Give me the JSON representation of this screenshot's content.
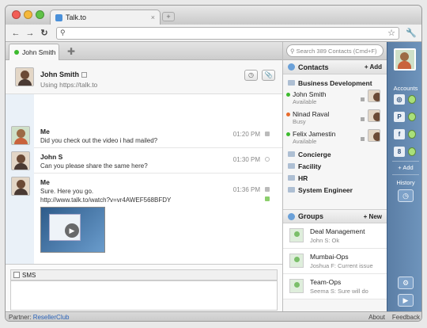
{
  "browser": {
    "tab_title": "Talk.to",
    "tab_close": "×",
    "new_tab": "+",
    "url": ""
  },
  "app_tabs": {
    "active": "John Smith",
    "add": "✚"
  },
  "chat_header": {
    "name": "John Smith",
    "subtitle": "Using https://talk.to"
  },
  "messages": [
    {
      "author": "Me",
      "text": "Did you check out the video i had mailed?",
      "time": "01:20 PM"
    },
    {
      "author": "John S",
      "text": "Can you please share the same here?",
      "time": "01:30 PM"
    },
    {
      "author": "Me",
      "text": "Sure. Here you go.",
      "link": "http://www.talk.to/watch?v=vr4AWEF568BFDY",
      "time": "01:36 PM"
    }
  ],
  "compose": {
    "sms_label": "SMS"
  },
  "search": {
    "placeholder": "Search 389 Contacts (Cmd+F)"
  },
  "contacts": {
    "title": "Contacts",
    "add": "+ Add",
    "folders": [
      {
        "label": "Business Development"
      },
      {
        "label": "Concierge"
      },
      {
        "label": "Facility"
      },
      {
        "label": "HR"
      },
      {
        "label": "System Engineer"
      }
    ],
    "people": [
      {
        "name": "John Smith",
        "status": "Available",
        "color": "#3dbb2f"
      },
      {
        "name": "Ninad Raval",
        "status": "Busy",
        "color": "#e86b2c"
      },
      {
        "name": "Felix Jamestin",
        "status": "Available",
        "color": "#3dbb2f"
      }
    ]
  },
  "groups": {
    "title": "Groups",
    "add": "+ New",
    "items": [
      {
        "name": "Deal Management",
        "sub": "John S: Ok"
      },
      {
        "name": "Mumbai-Ops",
        "sub": "Joshua F: Current issue"
      },
      {
        "name": "Team-Ops",
        "sub": "Seema S: Sure will do"
      }
    ]
  },
  "rail": {
    "accounts_label": "Accounts",
    "add_label": "+ Add",
    "history_label": "History",
    "account_letters": [
      "◎",
      "P",
      "f",
      "8"
    ]
  },
  "footer": {
    "partner_label": "Partner:",
    "partner_link": "ResellerClub",
    "about": "About",
    "feedback": "Feedback"
  }
}
